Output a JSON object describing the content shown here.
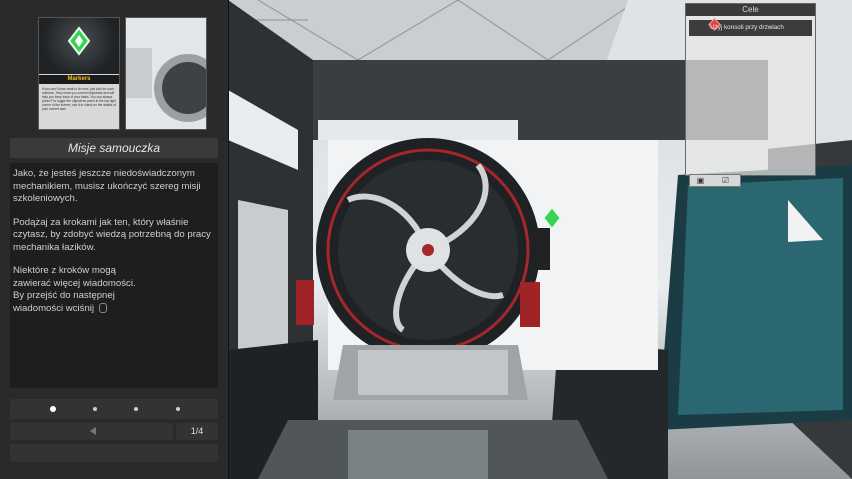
{
  "tutorial": {
    "thumbnail_title": "Markers",
    "thumbnail_text": "If you don't know what to do next, just look for such markers. They show you current objectives and will help you keep track of your tasks. You can always press F to toggle the objectives panel in the top right corner of the screen, use it to check on the details of your current task.",
    "title": "Misje samouczka",
    "paragraphs": [
      "Jako, że jesteś jeszcze niedoświadczonym mechanikiem, musisz ukończyć szereg misji szkoleniowych.",
      "Podążaj za krokami jak ten, który właśnie czytasz, by zdobyć wiedzą potrzebną do pracy mechanika łazików.",
      "Niektóre z kroków mogą zawierać więcej wiadomości. By przejść do następnej wiadomości wciśnij"
    ],
    "page_indicator": "1/4",
    "dots_total": 4,
    "dots_active_index": 0
  },
  "objectives": {
    "header": "Cele",
    "items": [
      {
        "label": "Użyj konsoli przy drzwiach",
        "icon": "diamond-marker-icon"
      }
    ],
    "tabs": [
      "book-icon",
      "checkbox-icon"
    ]
  },
  "colors": {
    "marker_green": "#39d353",
    "accent_yellow": "#f0c020",
    "objective_red": "#dd4444"
  }
}
